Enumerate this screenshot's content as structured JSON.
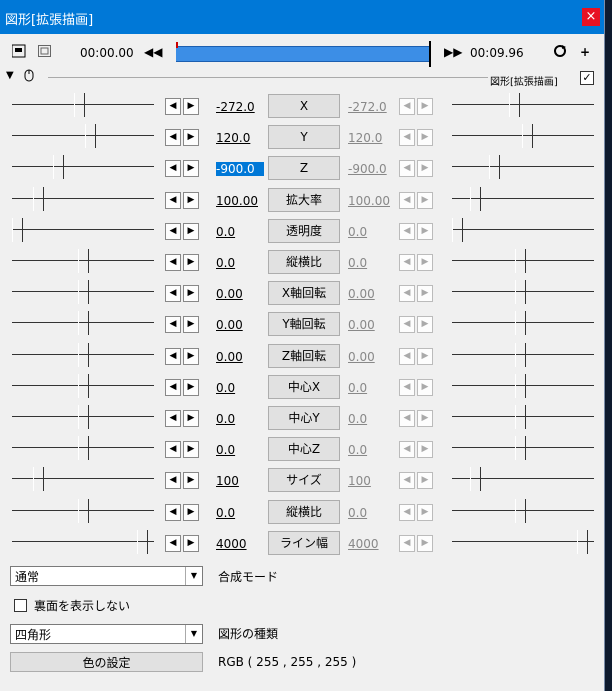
{
  "window": {
    "title": "図形[拡張描画]",
    "close_label": "×"
  },
  "timeline": {
    "start_time": "00:00.00",
    "end_time": "00:09.96",
    "prev_label": "◀◀",
    "next_label": "▶▶",
    "plus_label": "+"
  },
  "object": {
    "name": "図形[拡張描画]",
    "enabled_mark": "✓"
  },
  "params": [
    {
      "name": "X",
      "start": "-272.0",
      "end": "-272.0",
      "start_pos": 0.47,
      "end_pos": 0.43
    },
    {
      "name": "Y",
      "start": "120.0",
      "end": "120.0",
      "start_pos": 0.55,
      "end_pos": 0.53
    },
    {
      "name": "Z",
      "start": "-900.0",
      "end": "-900.0",
      "start_pos": 0.31,
      "end_pos": 0.28
    },
    {
      "name": "拡大率",
      "start": "100.00",
      "end": "100.00",
      "start_pos": 0.16,
      "end_pos": 0.14
    },
    {
      "name": "透明度",
      "start": "0.0",
      "end": "0.0",
      "start_pos": 0.0,
      "end_pos": 0.0
    },
    {
      "name": "縦横比",
      "start": "0.0",
      "end": "0.0",
      "start_pos": 0.5,
      "end_pos": 0.48
    },
    {
      "name": "X軸回転",
      "start": "0.00",
      "end": "0.00",
      "start_pos": 0.5,
      "end_pos": 0.48
    },
    {
      "name": "Y軸回転",
      "start": "0.00",
      "end": "0.00",
      "start_pos": 0.5,
      "end_pos": 0.48
    },
    {
      "name": "Z軸回転",
      "start": "0.00",
      "end": "0.00",
      "start_pos": 0.5,
      "end_pos": 0.48
    },
    {
      "name": "中心X",
      "start": "0.0",
      "end": "0.0",
      "start_pos": 0.5,
      "end_pos": 0.48
    },
    {
      "name": "中心Y",
      "start": "0.0",
      "end": "0.0",
      "start_pos": 0.5,
      "end_pos": 0.48
    },
    {
      "name": "中心Z",
      "start": "0.0",
      "end": "0.0",
      "start_pos": 0.5,
      "end_pos": 0.48
    },
    {
      "name": "サイズ",
      "start": "100",
      "end": "100",
      "start_pos": 0.16,
      "end_pos": 0.14
    },
    {
      "name": "縦横比",
      "start": "0.0",
      "end": "0.0",
      "start_pos": 0.5,
      "end_pos": 0.48
    },
    {
      "name": "ライン幅",
      "start": "4000",
      "end": "4000",
      "start_pos": 0.95,
      "end_pos": 0.95
    }
  ],
  "blend": {
    "value": "通常",
    "label": "合成モード"
  },
  "backface": {
    "label": "裏面を表示しない"
  },
  "shape": {
    "value": "四角形",
    "label": "図形の種類"
  },
  "color": {
    "button_label": "色の設定",
    "value": "RGB ( 255 , 255 , 255 )"
  },
  "colors": {
    "titlebar": "#0078d7",
    "close": "#e81123",
    "timeline_bar": "#3c8ee6",
    "selected": "#0078d7"
  }
}
